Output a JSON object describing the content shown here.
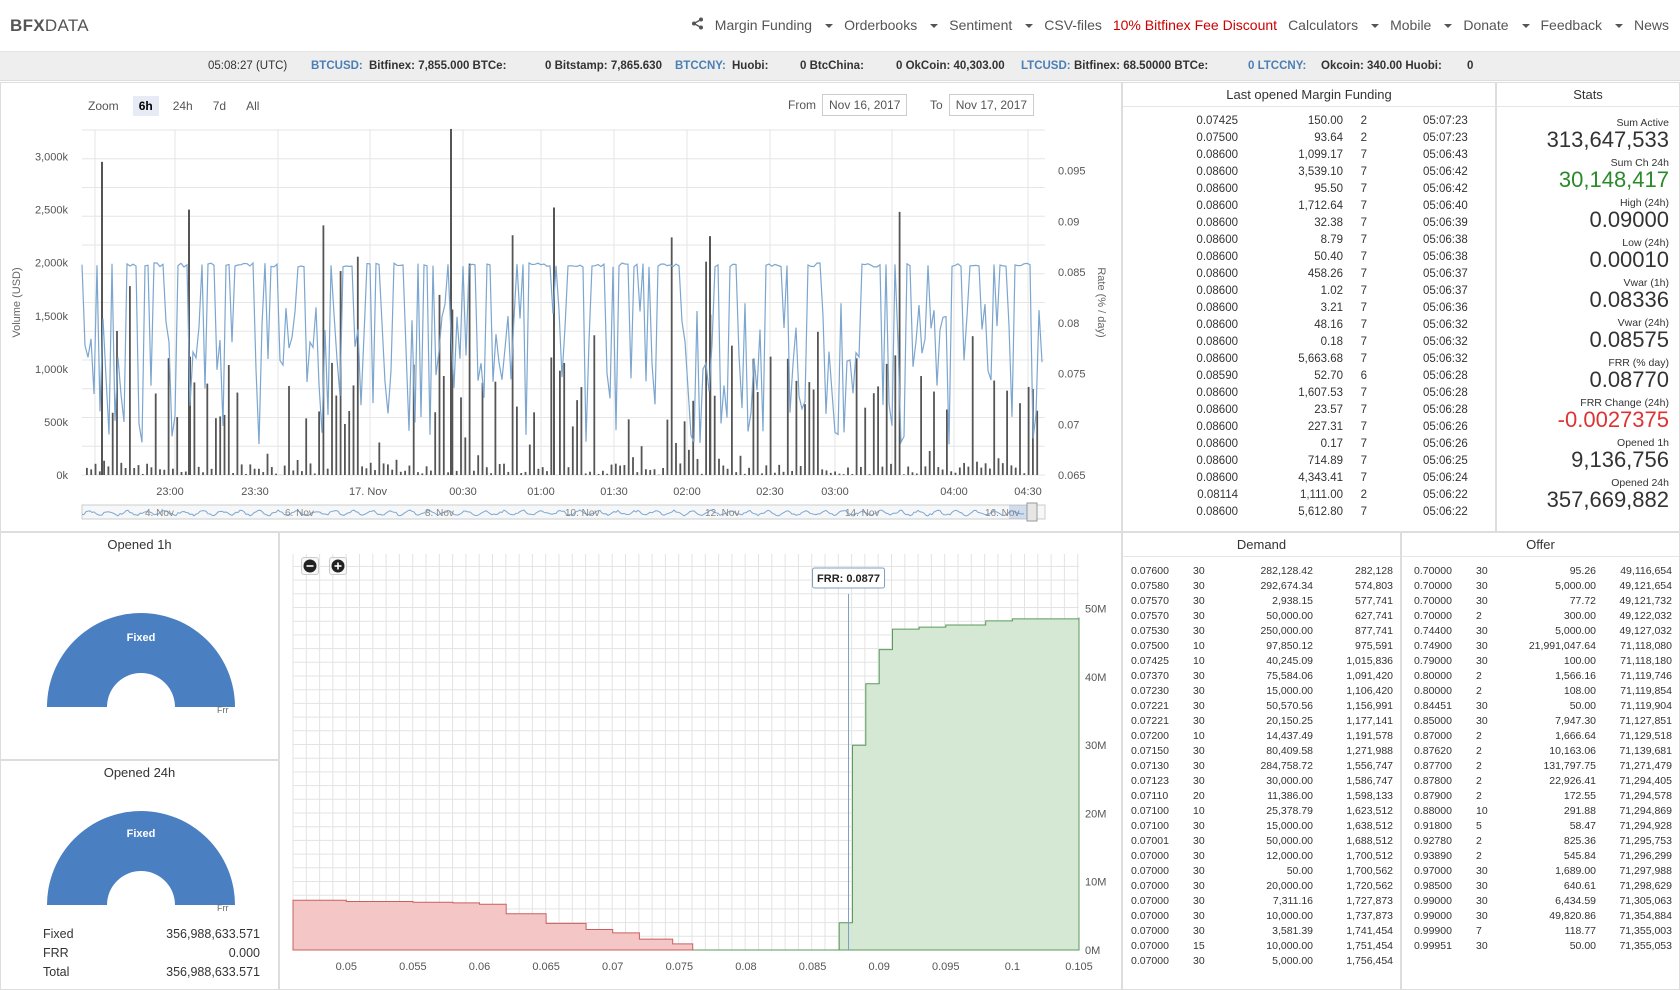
{
  "brand": {
    "bold": "BFX",
    "rest": "DATA"
  },
  "menu": [
    {
      "label": "Margin Funding",
      "caret": true
    },
    {
      "label": "Orderbooks",
      "caret": true
    },
    {
      "label": "Sentiment",
      "caret": true
    },
    {
      "label": "CSV-files",
      "caret": false
    },
    {
      "label": "10% Bitfinex Fee Discount",
      "caret": false,
      "highlight": true
    },
    {
      "label": "Calculators",
      "caret": true
    },
    {
      "label": "Mobile",
      "caret": true
    },
    {
      "label": "Donate",
      "caret": true
    },
    {
      "label": "Feedback",
      "caret": true
    },
    {
      "label": "News",
      "caret": false
    }
  ],
  "ticker": {
    "time": "05:08:27 (UTC)",
    "btcusd": "BTCUSD:",
    "btcusd_vals": "Bitfinex: 7,855.000 BTCe:",
    "btcusd_vals2": "0 Bitstamp: 7,865.630",
    "btccny": "BTCCNY:",
    "btccny_vals": "Huobi:",
    "btccny_vals2": "0 BtcChina:",
    "btccny_vals3": "0 OkCoin: 40,303.00",
    "ltcusd": "LTCUSD:",
    "ltcusd_vals": "Bitfinex: 68.50000 BTCe:",
    "ltccny": "0 LTCCNY:",
    "ltccny_vals": "Okcoin: 340.00 Huobi:",
    "ltccny_vals2": "0"
  },
  "chart_data": [
    {
      "type": "line",
      "title": "",
      "ylabel": "Volume (USD)",
      "y2label": "Rate (% / day)",
      "ylim": [
        0,
        3250000
      ],
      "y2lim": [
        0.065,
        0.099
      ],
      "yticks": [
        "0k",
        "500k",
        "1,000k",
        "1,500k",
        "2,000k",
        "2,500k",
        "3,000k"
      ],
      "y2ticks": [
        "0.065",
        "0.07",
        "0.075",
        "0.08",
        "0.085",
        "0.09",
        "0.095"
      ],
      "xticks": [
        "23:00",
        "23:30",
        "17. Nov",
        "00:30",
        "01:00",
        "01:30",
        "02:00",
        "02:30",
        "03:00",
        "04:00",
        "04:30"
      ],
      "navigator_labels": [
        "4. Nov",
        "6. Nov",
        "8. Nov",
        "10. Nov",
        "12. Nov",
        "14. Nov",
        "16. Nov"
      ],
      "series": [
        {
          "name": "Volume",
          "type": "bar",
          "color": "#555555"
        },
        {
          "name": "Rate",
          "type": "line",
          "color": "#7ca6cf"
        }
      ]
    },
    {
      "type": "area",
      "title": "",
      "annotation": "FRR: 0.0877",
      "xticks": [
        "0.05",
        "0.055",
        "0.06",
        "0.065",
        "0.07",
        "0.075",
        "0.08",
        "0.085",
        "0.09",
        "0.095",
        "0.1",
        "0.105"
      ],
      "yticks": [
        "0M",
        "10M",
        "20M",
        "30M",
        "40M",
        "50M"
      ],
      "xlim": [
        0.046,
        0.105
      ],
      "ylim": [
        0,
        58000000
      ],
      "series": [
        {
          "name": "Demand",
          "color": "#f4c6c6",
          "x": [
            0.046,
            0.05,
            0.055,
            0.058,
            0.06,
            0.062,
            0.065,
            0.068,
            0.07,
            0.072,
            0.0745,
            0.076
          ],
          "y": [
            7300000,
            7100000,
            7000000,
            6900000,
            6700000,
            5300000,
            3900000,
            3000000,
            2500000,
            1600000,
            900000,
            0
          ]
        },
        {
          "name": "Offer",
          "color": "#d5e8d4",
          "x": [
            0.0865,
            0.087,
            0.088,
            0.089,
            0.09,
            0.091,
            0.093,
            0.095,
            0.098,
            0.1,
            0.105
          ],
          "y": [
            0,
            4000000,
            30000000,
            39000000,
            44000000,
            47000000,
            47300000,
            47600000,
            48200000,
            48500000,
            48700000
          ]
        }
      ]
    }
  ],
  "zoom": {
    "label": "Zoom",
    "options": [
      "6h",
      "24h",
      "7d",
      "All"
    ],
    "selected": "6h"
  },
  "range": {
    "from_label": "From",
    "from": "Nov 16, 2017",
    "to_label": "To",
    "to": "Nov 17, 2017"
  },
  "margin": {
    "title": "Last opened Margin Funding",
    "rows": [
      [
        "0.07425",
        "150.00",
        "2",
        "05:07:23"
      ],
      [
        "0.07500",
        "93.64",
        "2",
        "05:07:23"
      ],
      [
        "0.08600",
        "1,099.17",
        "7",
        "05:06:43"
      ],
      [
        "0.08600",
        "3,539.10",
        "7",
        "05:06:42"
      ],
      [
        "0.08600",
        "95.50",
        "7",
        "05:06:42"
      ],
      [
        "0.08600",
        "1,712.64",
        "7",
        "05:06:40"
      ],
      [
        "0.08600",
        "32.38",
        "7",
        "05:06:39"
      ],
      [
        "0.08600",
        "8.79",
        "7",
        "05:06:38"
      ],
      [
        "0.08600",
        "50.40",
        "7",
        "05:06:38"
      ],
      [
        "0.08600",
        "458.26",
        "7",
        "05:06:37"
      ],
      [
        "0.08600",
        "1.02",
        "7",
        "05:06:37"
      ],
      [
        "0.08600",
        "3.21",
        "7",
        "05:06:36"
      ],
      [
        "0.08600",
        "48.16",
        "7",
        "05:06:32"
      ],
      [
        "0.08600",
        "0.18",
        "7",
        "05:06:32"
      ],
      [
        "0.08600",
        "5,663.68",
        "7",
        "05:06:32"
      ],
      [
        "0.08590",
        "52.70",
        "6",
        "05:06:28"
      ],
      [
        "0.08600",
        "1,607.53",
        "7",
        "05:06:28"
      ],
      [
        "0.08600",
        "23.57",
        "7",
        "05:06:28"
      ],
      [
        "0.08600",
        "227.31",
        "7",
        "05:06:26"
      ],
      [
        "0.08600",
        "0.17",
        "7",
        "05:06:26"
      ],
      [
        "0.08600",
        "714.89",
        "7",
        "05:06:25"
      ],
      [
        "0.08600",
        "4,343.41",
        "7",
        "05:06:24"
      ],
      [
        "0.08114",
        "1,111.00",
        "2",
        "05:06:22"
      ],
      [
        "0.08600",
        "5,612.80",
        "7",
        "05:06:22"
      ]
    ]
  },
  "stats": {
    "title": "Stats",
    "items": [
      {
        "label": "Sum Active",
        "value": "313,647,533",
        "tone": "normal"
      },
      {
        "label": "Sum Ch 24h",
        "value": "30,148,417",
        "tone": "green"
      },
      {
        "label": "High (24h)",
        "value": "0.09000",
        "tone": "normal"
      },
      {
        "label": "Low (24h)",
        "value": "0.00010",
        "tone": "normal"
      },
      {
        "label": "Vwar (1h)",
        "value": "0.08336",
        "tone": "normal"
      },
      {
        "label": "Vwar (24h)",
        "value": "0.08575",
        "tone": "normal"
      },
      {
        "label": "FRR (% day)",
        "value": "0.08770",
        "tone": "normal"
      },
      {
        "label": "FRR Change (24h)",
        "value": "-0.0027375",
        "tone": "red"
      },
      {
        "label": "Opened 1h",
        "value": "9,136,756",
        "tone": "normal"
      },
      {
        "label": "Opened 24h",
        "value": "357,669,882",
        "tone": "normal"
      }
    ]
  },
  "opened1h": {
    "title": "Opened 1h",
    "fixed": "Fixed",
    "frr": "Frr"
  },
  "opened24h": {
    "title": "Opened 24h",
    "fixed": "Fixed",
    "frr": "Frr",
    "legend": [
      {
        "label": "Fixed",
        "value": "356,988,633.571"
      },
      {
        "label": "FRR",
        "value": "0.000"
      },
      {
        "label": "Total",
        "value": "356,988,633.571"
      }
    ]
  },
  "demand": {
    "title": "Demand",
    "rows": [
      [
        "0.07600",
        "30",
        "282,128.42",
        "282,128"
      ],
      [
        "0.07580",
        "30",
        "292,674.34",
        "574,803"
      ],
      [
        "0.07570",
        "30",
        "2,938.15",
        "577,741"
      ],
      [
        "0.07570",
        "30",
        "50,000.00",
        "627,741"
      ],
      [
        "0.07530",
        "30",
        "250,000.00",
        "877,741"
      ],
      [
        "0.07500",
        "10",
        "97,850.12",
        "975,591"
      ],
      [
        "0.07425",
        "10",
        "40,245.09",
        "1,015,836"
      ],
      [
        "0.07370",
        "30",
        "75,584.06",
        "1,091,420"
      ],
      [
        "0.07230",
        "30",
        "15,000.00",
        "1,106,420"
      ],
      [
        "0.07221",
        "30",
        "50,570.56",
        "1,156,991"
      ],
      [
        "0.07221",
        "30",
        "20,150.25",
        "1,177,141"
      ],
      [
        "0.07200",
        "10",
        "14,437.49",
        "1,191,578"
      ],
      [
        "0.07150",
        "30",
        "80,409.58",
        "1,271,988"
      ],
      [
        "0.07130",
        "30",
        "284,758.72",
        "1,556,747"
      ],
      [
        "0.07123",
        "30",
        "30,000.00",
        "1,586,747"
      ],
      [
        "0.07110",
        "20",
        "11,386.00",
        "1,598,133"
      ],
      [
        "0.07100",
        "10",
        "25,378.79",
        "1,623,512"
      ],
      [
        "0.07100",
        "30",
        "15,000.00",
        "1,638,512"
      ],
      [
        "0.07001",
        "30",
        "50,000.00",
        "1,688,512"
      ],
      [
        "0.07000",
        "30",
        "12,000.00",
        "1,700,512"
      ],
      [
        "0.07000",
        "30",
        "50.00",
        "1,700,562"
      ],
      [
        "0.07000",
        "30",
        "20,000.00",
        "1,720,562"
      ],
      [
        "0.07000",
        "30",
        "7,311.16",
        "1,727,873"
      ],
      [
        "0.07000",
        "30",
        "10,000.00",
        "1,737,873"
      ],
      [
        "0.07000",
        "30",
        "3,581.39",
        "1,741,454"
      ],
      [
        "0.07000",
        "15",
        "10,000.00",
        "1,751,454"
      ],
      [
        "0.07000",
        "30",
        "5,000.00",
        "1,756,454"
      ]
    ]
  },
  "offer": {
    "title": "Offer",
    "rows": [
      [
        "0.70000",
        "30",
        "95.26",
        "49,116,654"
      ],
      [
        "0.70000",
        "30",
        "5,000.00",
        "49,121,654"
      ],
      [
        "0.70000",
        "30",
        "77.72",
        "49,121,732"
      ],
      [
        "0.70000",
        "2",
        "300.00",
        "49,122,032"
      ],
      [
        "0.74400",
        "30",
        "5,000.00",
        "49,127,032"
      ],
      [
        "0.74900",
        "30",
        "21,991,047.64",
        "71,118,080"
      ],
      [
        "0.79000",
        "30",
        "100.00",
        "71,118,180"
      ],
      [
        "0.80000",
        "2",
        "1,566.16",
        "71,119,746"
      ],
      [
        "0.80000",
        "2",
        "108.00",
        "71,119,854"
      ],
      [
        "0.84451",
        "30",
        "50.00",
        "71,119,904"
      ],
      [
        "0.85000",
        "30",
        "7,947.30",
        "71,127,851"
      ],
      [
        "0.87000",
        "2",
        "1,666.64",
        "71,129,518"
      ],
      [
        "0.87620",
        "2",
        "10,163.06",
        "71,139,681"
      ],
      [
        "0.87700",
        "2",
        "131,797.75",
        "71,271,479"
      ],
      [
        "0.87800",
        "2",
        "22,926.41",
        "71,294,405"
      ],
      [
        "0.87900",
        "2",
        "172.55",
        "71,294,578"
      ],
      [
        "0.88000",
        "10",
        "291.88",
        "71,294,869"
      ],
      [
        "0.91800",
        "5",
        "58.47",
        "71,294,928"
      ],
      [
        "0.92780",
        "2",
        "825.36",
        "71,295,753"
      ],
      [
        "0.93890",
        "2",
        "545.84",
        "71,296,299"
      ],
      [
        "0.97000",
        "30",
        "1,689.00",
        "71,297,988"
      ],
      [
        "0.98500",
        "30",
        "640.61",
        "71,298,629"
      ],
      [
        "0.99000",
        "30",
        "6,434.59",
        "71,305,063"
      ],
      [
        "0.99000",
        "30",
        "49,820.86",
        "71,354,884"
      ],
      [
        "0.99900",
        "7",
        "118.77",
        "71,355,003"
      ],
      [
        "0.99951",
        "30",
        "50.00",
        "71,355,053"
      ]
    ]
  }
}
